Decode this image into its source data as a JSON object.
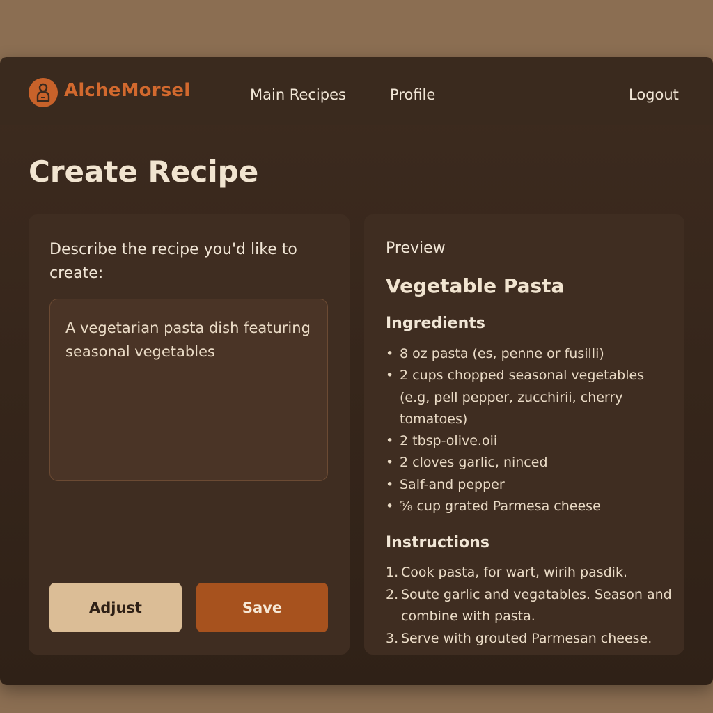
{
  "app": {
    "name": "AlcheMorsel",
    "icon": "chef-icon"
  },
  "nav": {
    "main_recipes": "Main Recipes",
    "profile": "Profile",
    "logout": "Logout"
  },
  "page": {
    "title": "Create Recipe"
  },
  "prompt": {
    "label": "Describe the recipe you'd like to create:",
    "value": "A vegetarian pasta dish featuring seasonal vegetables"
  },
  "actions": {
    "adjust_label": "Adjust",
    "save_label": "Save"
  },
  "preview": {
    "label": "Preview",
    "recipe_title": "Vegetable Pasta",
    "ingredients_heading": "Ingredients",
    "ingredients": [
      "8 oz pasta (es, penne or fusilli)",
      "2 cups chopped seasonal vegetables (e.g, pell pepper, zucchirii, cherry tomatoes)",
      "2 tbsp-olive.oii",
      "2 cloves garlic, ninced",
      "Salf-and pepper",
      "⅝ cup grated Parmesa cheese"
    ],
    "instructions_heading": "Instructions",
    "instructions": [
      "Cook pasta, for wart, wirih pasdik.",
      "Soute garlic and vegatables. Season and combine with pasta.",
      "Serve with grouted Parmesan cheese."
    ]
  },
  "colors": {
    "background": "#8b6e52",
    "window": "#3d2b1f",
    "accent": "#d2692e",
    "save_button": "#a7521e",
    "adjust_button": "#dbbd96"
  }
}
